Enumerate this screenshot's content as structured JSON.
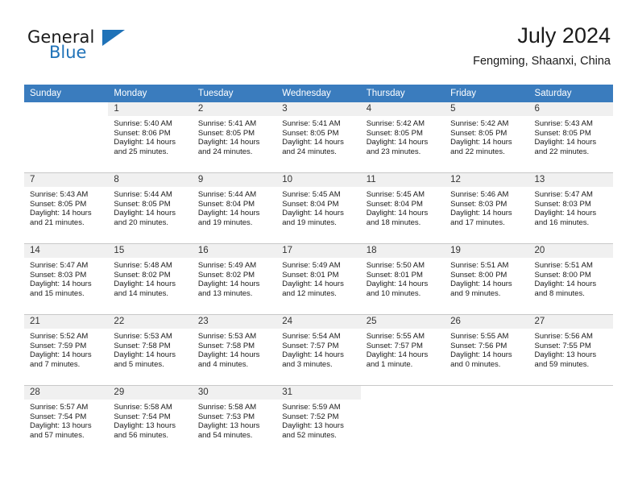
{
  "brand": {
    "name_part1": "General",
    "name_part2": "Blue",
    "triangle_color": "#1f72b8"
  },
  "header": {
    "title": "July 2024",
    "subtitle": "Fengming, Shaanxi, China"
  },
  "theme": {
    "header_bg": "#3a7cbe",
    "header_text": "#ffffff",
    "daynum_band_bg": "#f0f0f0",
    "row_divider": "#c8c8c8"
  },
  "weekday_headers": [
    "Sunday",
    "Monday",
    "Tuesday",
    "Wednesday",
    "Thursday",
    "Friday",
    "Saturday"
  ],
  "weeks": [
    [
      {
        "day": "",
        "sunrise": "",
        "sunset": "",
        "daylight_1": "",
        "daylight_2": "",
        "empty": true
      },
      {
        "day": "1",
        "sunrise": "Sunrise: 5:40 AM",
        "sunset": "Sunset: 8:06 PM",
        "daylight_1": "Daylight: 14 hours",
        "daylight_2": "and 25 minutes.",
        "empty": false
      },
      {
        "day": "2",
        "sunrise": "Sunrise: 5:41 AM",
        "sunset": "Sunset: 8:05 PM",
        "daylight_1": "Daylight: 14 hours",
        "daylight_2": "and 24 minutes.",
        "empty": false
      },
      {
        "day": "3",
        "sunrise": "Sunrise: 5:41 AM",
        "sunset": "Sunset: 8:05 PM",
        "daylight_1": "Daylight: 14 hours",
        "daylight_2": "and 24 minutes.",
        "empty": false
      },
      {
        "day": "4",
        "sunrise": "Sunrise: 5:42 AM",
        "sunset": "Sunset: 8:05 PM",
        "daylight_1": "Daylight: 14 hours",
        "daylight_2": "and 23 minutes.",
        "empty": false
      },
      {
        "day": "5",
        "sunrise": "Sunrise: 5:42 AM",
        "sunset": "Sunset: 8:05 PM",
        "daylight_1": "Daylight: 14 hours",
        "daylight_2": "and 22 minutes.",
        "empty": false
      },
      {
        "day": "6",
        "sunrise": "Sunrise: 5:43 AM",
        "sunset": "Sunset: 8:05 PM",
        "daylight_1": "Daylight: 14 hours",
        "daylight_2": "and 22 minutes.",
        "empty": false
      }
    ],
    [
      {
        "day": "7",
        "sunrise": "Sunrise: 5:43 AM",
        "sunset": "Sunset: 8:05 PM",
        "daylight_1": "Daylight: 14 hours",
        "daylight_2": "and 21 minutes.",
        "empty": false
      },
      {
        "day": "8",
        "sunrise": "Sunrise: 5:44 AM",
        "sunset": "Sunset: 8:05 PM",
        "daylight_1": "Daylight: 14 hours",
        "daylight_2": "and 20 minutes.",
        "empty": false
      },
      {
        "day": "9",
        "sunrise": "Sunrise: 5:44 AM",
        "sunset": "Sunset: 8:04 PM",
        "daylight_1": "Daylight: 14 hours",
        "daylight_2": "and 19 minutes.",
        "empty": false
      },
      {
        "day": "10",
        "sunrise": "Sunrise: 5:45 AM",
        "sunset": "Sunset: 8:04 PM",
        "daylight_1": "Daylight: 14 hours",
        "daylight_2": "and 19 minutes.",
        "empty": false
      },
      {
        "day": "11",
        "sunrise": "Sunrise: 5:45 AM",
        "sunset": "Sunset: 8:04 PM",
        "daylight_1": "Daylight: 14 hours",
        "daylight_2": "and 18 minutes.",
        "empty": false
      },
      {
        "day": "12",
        "sunrise": "Sunrise: 5:46 AM",
        "sunset": "Sunset: 8:03 PM",
        "daylight_1": "Daylight: 14 hours",
        "daylight_2": "and 17 minutes.",
        "empty": false
      },
      {
        "day": "13",
        "sunrise": "Sunrise: 5:47 AM",
        "sunset": "Sunset: 8:03 PM",
        "daylight_1": "Daylight: 14 hours",
        "daylight_2": "and 16 minutes.",
        "empty": false
      }
    ],
    [
      {
        "day": "14",
        "sunrise": "Sunrise: 5:47 AM",
        "sunset": "Sunset: 8:03 PM",
        "daylight_1": "Daylight: 14 hours",
        "daylight_2": "and 15 minutes.",
        "empty": false
      },
      {
        "day": "15",
        "sunrise": "Sunrise: 5:48 AM",
        "sunset": "Sunset: 8:02 PM",
        "daylight_1": "Daylight: 14 hours",
        "daylight_2": "and 14 minutes.",
        "empty": false
      },
      {
        "day": "16",
        "sunrise": "Sunrise: 5:49 AM",
        "sunset": "Sunset: 8:02 PM",
        "daylight_1": "Daylight: 14 hours",
        "daylight_2": "and 13 minutes.",
        "empty": false
      },
      {
        "day": "17",
        "sunrise": "Sunrise: 5:49 AM",
        "sunset": "Sunset: 8:01 PM",
        "daylight_1": "Daylight: 14 hours",
        "daylight_2": "and 12 minutes.",
        "empty": false
      },
      {
        "day": "18",
        "sunrise": "Sunrise: 5:50 AM",
        "sunset": "Sunset: 8:01 PM",
        "daylight_1": "Daylight: 14 hours",
        "daylight_2": "and 10 minutes.",
        "empty": false
      },
      {
        "day": "19",
        "sunrise": "Sunrise: 5:51 AM",
        "sunset": "Sunset: 8:00 PM",
        "daylight_1": "Daylight: 14 hours",
        "daylight_2": "and 9 minutes.",
        "empty": false
      },
      {
        "day": "20",
        "sunrise": "Sunrise: 5:51 AM",
        "sunset": "Sunset: 8:00 PM",
        "daylight_1": "Daylight: 14 hours",
        "daylight_2": "and 8 minutes.",
        "empty": false
      }
    ],
    [
      {
        "day": "21",
        "sunrise": "Sunrise: 5:52 AM",
        "sunset": "Sunset: 7:59 PM",
        "daylight_1": "Daylight: 14 hours",
        "daylight_2": "and 7 minutes.",
        "empty": false
      },
      {
        "day": "22",
        "sunrise": "Sunrise: 5:53 AM",
        "sunset": "Sunset: 7:58 PM",
        "daylight_1": "Daylight: 14 hours",
        "daylight_2": "and 5 minutes.",
        "empty": false
      },
      {
        "day": "23",
        "sunrise": "Sunrise: 5:53 AM",
        "sunset": "Sunset: 7:58 PM",
        "daylight_1": "Daylight: 14 hours",
        "daylight_2": "and 4 minutes.",
        "empty": false
      },
      {
        "day": "24",
        "sunrise": "Sunrise: 5:54 AM",
        "sunset": "Sunset: 7:57 PM",
        "daylight_1": "Daylight: 14 hours",
        "daylight_2": "and 3 minutes.",
        "empty": false
      },
      {
        "day": "25",
        "sunrise": "Sunrise: 5:55 AM",
        "sunset": "Sunset: 7:57 PM",
        "daylight_1": "Daylight: 14 hours",
        "daylight_2": "and 1 minute.",
        "empty": false
      },
      {
        "day": "26",
        "sunrise": "Sunrise: 5:55 AM",
        "sunset": "Sunset: 7:56 PM",
        "daylight_1": "Daylight: 14 hours",
        "daylight_2": "and 0 minutes.",
        "empty": false
      },
      {
        "day": "27",
        "sunrise": "Sunrise: 5:56 AM",
        "sunset": "Sunset: 7:55 PM",
        "daylight_1": "Daylight: 13 hours",
        "daylight_2": "and 59 minutes.",
        "empty": false
      }
    ],
    [
      {
        "day": "28",
        "sunrise": "Sunrise: 5:57 AM",
        "sunset": "Sunset: 7:54 PM",
        "daylight_1": "Daylight: 13 hours",
        "daylight_2": "and 57 minutes.",
        "empty": false
      },
      {
        "day": "29",
        "sunrise": "Sunrise: 5:58 AM",
        "sunset": "Sunset: 7:54 PM",
        "daylight_1": "Daylight: 13 hours",
        "daylight_2": "and 56 minutes.",
        "empty": false
      },
      {
        "day": "30",
        "sunrise": "Sunrise: 5:58 AM",
        "sunset": "Sunset: 7:53 PM",
        "daylight_1": "Daylight: 13 hours",
        "daylight_2": "and 54 minutes.",
        "empty": false
      },
      {
        "day": "31",
        "sunrise": "Sunrise: 5:59 AM",
        "sunset": "Sunset: 7:52 PM",
        "daylight_1": "Daylight: 13 hours",
        "daylight_2": "and 52 minutes.",
        "empty": false
      },
      {
        "day": "",
        "sunrise": "",
        "sunset": "",
        "daylight_1": "",
        "daylight_2": "",
        "empty": true
      },
      {
        "day": "",
        "sunrise": "",
        "sunset": "",
        "daylight_1": "",
        "daylight_2": "",
        "empty": true
      },
      {
        "day": "",
        "sunrise": "",
        "sunset": "",
        "daylight_1": "",
        "daylight_2": "",
        "empty": true
      }
    ]
  ]
}
